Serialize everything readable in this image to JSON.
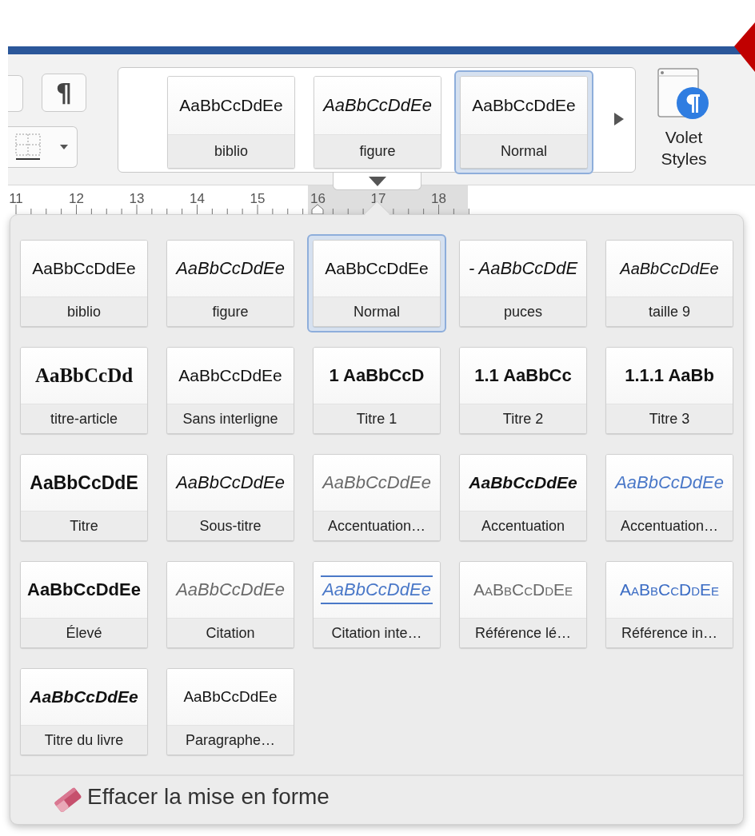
{
  "ribbon": {
    "show_marks_button": "¶",
    "gallery": [
      {
        "label": "biblio",
        "preview": "AaBbCcDdEe",
        "kind": "plain",
        "selected": false
      },
      {
        "label": "figure",
        "preview": "AaBbCcDdEe",
        "kind": "italic",
        "selected": false
      },
      {
        "label": "Normal",
        "preview": "AaBbCcDdEe",
        "kind": "plain",
        "selected": true
      }
    ],
    "styles_pane": "Volet Styles"
  },
  "ruler": {
    "numbers": [
      "11",
      "12",
      "13",
      "14",
      "15",
      "16",
      "17",
      "18"
    ]
  },
  "styles_menu": {
    "items": [
      {
        "label": "biblio",
        "preview": "AaBbCcDdEe",
        "kind": "plain",
        "selected": false
      },
      {
        "label": "figure",
        "preview": "AaBbCcDdEe",
        "kind": "italic",
        "selected": false
      },
      {
        "label": "Normal",
        "preview": "AaBbCcDdEe",
        "kind": "plain",
        "selected": true
      },
      {
        "label": "puces",
        "preview": "-  AaBbCcDdE",
        "kind": "italic",
        "selected": false
      },
      {
        "label": "taille 9",
        "preview": "AaBbCcDdEe",
        "kind": "italic-small",
        "selected": false
      },
      {
        "label": "titre-article",
        "preview": "AaBbCcDd",
        "kind": "serif-bold",
        "selected": false
      },
      {
        "label": "Sans interligne",
        "preview": "AaBbCcDdEe",
        "kind": "plain",
        "selected": false
      },
      {
        "label": "Titre 1",
        "preview": "1  AaBbCcD",
        "kind": "bold",
        "selected": false
      },
      {
        "label": "Titre 2",
        "preview": "1.1  AaBbCc",
        "kind": "bold",
        "selected": false
      },
      {
        "label": "Titre 3",
        "preview": "1.1.1  AaBb",
        "kind": "bold",
        "selected": false
      },
      {
        "label": "Titre",
        "preview": "AaBbCcDdE",
        "kind": "large",
        "selected": false
      },
      {
        "label": "Sous-titre",
        "preview": "AaBbCcDdEe",
        "kind": "italic",
        "selected": false
      },
      {
        "label": "Accentuation…",
        "preview": "AaBbCcDdEe",
        "kind": "italic-grey",
        "selected": false
      },
      {
        "label": "Accentuation",
        "preview": "AaBbCcDdEe",
        "kind": "italic-bold",
        "selected": false
      },
      {
        "label": "Accentuation…",
        "preview": "AaBbCcDdEe",
        "kind": "italic-blue",
        "selected": false
      },
      {
        "label": "Élevé",
        "preview": "AaBbCcDdEe",
        "kind": "bold",
        "selected": false
      },
      {
        "label": "Citation",
        "preview": "AaBbCcDdEe",
        "kind": "italic-grey",
        "selected": false
      },
      {
        "label": "Citation inte…",
        "preview": "AaBbCcDdEe",
        "kind": "quote-blue",
        "selected": false
      },
      {
        "label": "Référence lé…",
        "preview": "AaBbCcDdEe",
        "kind": "caps-grey",
        "selected": false
      },
      {
        "label": "Référence in…",
        "preview": "AaBbCcDdEe",
        "kind": "caps-blue",
        "selected": false
      },
      {
        "label": "Titre du livre",
        "preview": "AaBbCcDdEe",
        "kind": "italic-bold",
        "selected": false
      },
      {
        "label": "Paragraphe…",
        "preview": "AaBbCcDdEe",
        "kind": "plain-small",
        "selected": false
      }
    ],
    "footer": "Effacer la mise en forme"
  }
}
